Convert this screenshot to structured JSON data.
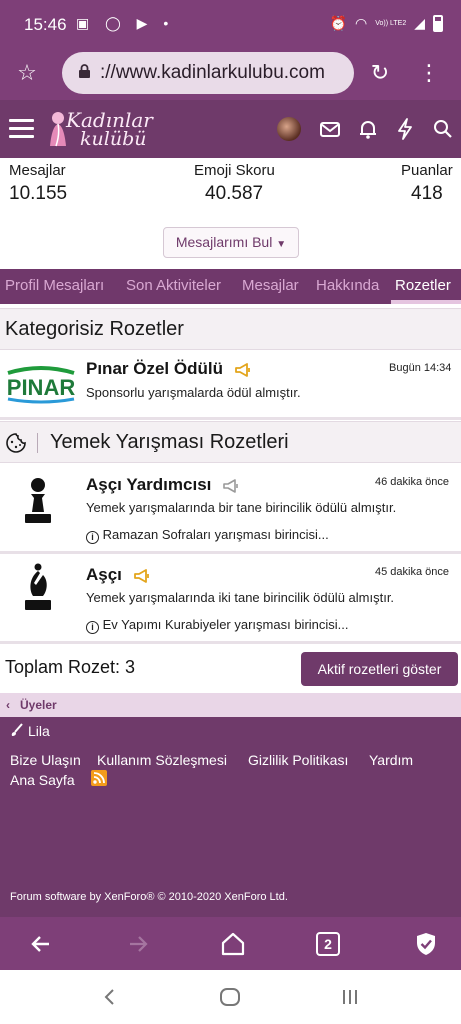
{
  "status_bar": {
    "time": "15:46",
    "network_label": "Vo)) LTE2"
  },
  "browser": {
    "url": "://www.kadinlarkulubu.com",
    "tabs_count": "2"
  },
  "site": {
    "logo_line1": "Kadınlar",
    "logo_line2": "kulübü"
  },
  "stats": {
    "messages_label": "Mesajlar",
    "messages_value": "10.155",
    "emoji_label": "Emoji Skoru",
    "emoji_value": "40.587",
    "points_label": "Puanlar",
    "points_value": "418"
  },
  "find_messages_button": "Mesajlarımı Bul",
  "tabs": [
    {
      "label": "Profil Mesajları"
    },
    {
      "label": "Son Aktiviteler"
    },
    {
      "label": "Mesajlar"
    },
    {
      "label": "Hakkında"
    },
    {
      "label": "Rozetler"
    }
  ],
  "sections": [
    {
      "title": "Kategorisiz Rozetler",
      "badges": [
        {
          "logo_text": "PINAR",
          "title": "Pınar Özel Ödülü",
          "time": "Bugün 14:34",
          "description": "Sponsorlu yarışmalarda ödül almıştır.",
          "note": ""
        }
      ]
    },
    {
      "title": "Yemek Yarışması Rozetleri",
      "badges": [
        {
          "title": "Aşçı Yardımcısı",
          "time": "46 dakika önce",
          "description": "Yemek yarışmalarında bir tane birincilik ödülü almıştır.",
          "note": "Ramazan Sofraları yarışması birincisi..."
        },
        {
          "title": "Aşçı",
          "time": "45 dakika önce",
          "description": "Yemek yarışmalarında iki tane birincilik ödülü almıştır.",
          "note": "Ev Yapımı Kurabiyeler yarışması birincisi..."
        }
      ]
    }
  ],
  "total_label": "Toplam Rozet: 3",
  "show_active_button": "Aktif rozetleri göster",
  "breadcrumb": "Üyeler",
  "footer": {
    "style_label": "Lila",
    "links": [
      "Bize Ulaşın",
      "Kullanım Sözleşmesi",
      "Gizlilik Politikası",
      "Yardım",
      "Ana Sayfa"
    ],
    "copyright": "Forum software by XenForo® © 2010-2020 XenForo Ltd."
  },
  "colors": {
    "brand": "#6f3a6a",
    "status_bar": "#7e3f78",
    "gold": "#e3a51c",
    "rss": "#f39c1c"
  }
}
